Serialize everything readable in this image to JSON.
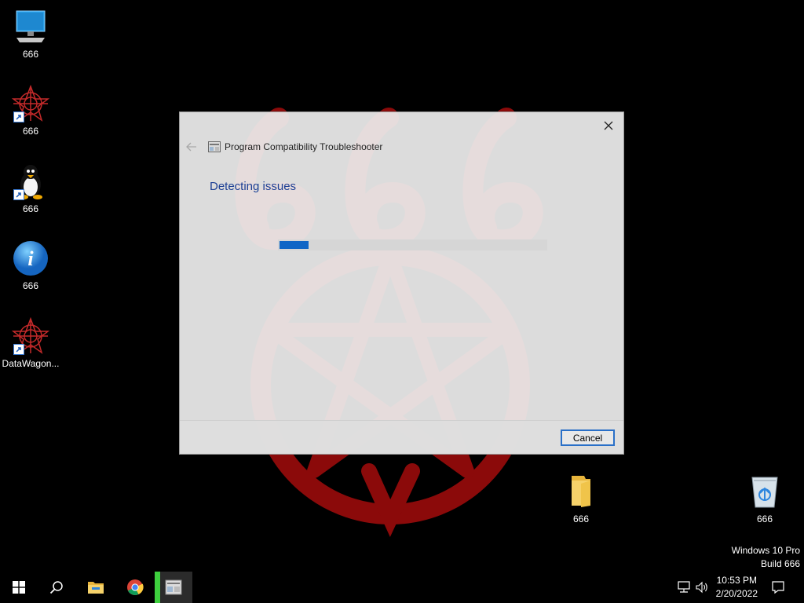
{
  "desktop": {
    "icons": [
      {
        "label": "666",
        "icon": "computer-icon"
      },
      {
        "label": "666",
        "icon": "red-pattern-shortcut-icon"
      },
      {
        "label": "666",
        "icon": "linux-penguin-shortcut-icon"
      },
      {
        "label": "666",
        "icon": "info-shortcut-icon"
      },
      {
        "label": "DataWagon...",
        "icon": "red-pattern-shortcut-icon"
      },
      {
        "label": "666",
        "icon": "folder-icon"
      },
      {
        "label": "666",
        "icon": "recycle-bin-icon"
      }
    ],
    "wallpaper": {
      "text": "666",
      "color": "#8b0000"
    }
  },
  "dialog": {
    "title": "Program Compatibility Troubleshooter",
    "heading": "Detecting issues",
    "progress": 0.11,
    "cancel_label": "Cancel",
    "accent": "#1166c6"
  },
  "watermark": {
    "line1": "Windows 10 Pro",
    "line2": "Build 666"
  },
  "taskbar": {
    "items": [
      "windows-start-icon",
      "search-icon",
      "file-explorer-icon",
      "chrome-icon",
      "troubleshooter-icon"
    ],
    "time": "10:53 PM",
    "date": "2/20/2022",
    "tray": [
      "network-icon",
      "volume-icon",
      "notification-icon"
    ]
  }
}
